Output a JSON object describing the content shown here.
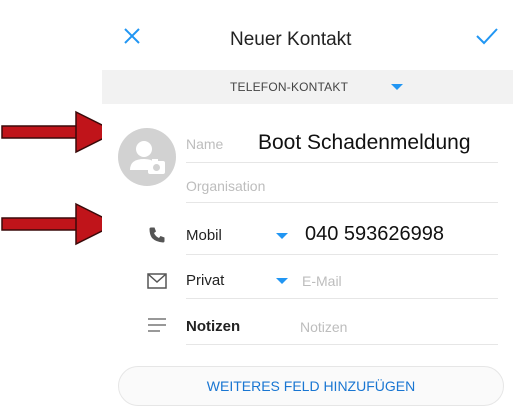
{
  "header": {
    "title": "Neuer Kontakt"
  },
  "contact_type": {
    "label": "TELEFON-KONTAKT"
  },
  "fields": {
    "name_label": "Name",
    "name_value": "Boot Schadenmeldung",
    "organisation_placeholder": "Organisation",
    "phone_type": "Mobil",
    "phone_value": "040 593626998",
    "email_type": "Privat",
    "email_placeholder": "E-Mail",
    "notes_label": "Notizen",
    "notes_placeholder": "Notizen"
  },
  "footer": {
    "add_field_label": "WEITERES FELD HINZUFÜGEN"
  },
  "colors": {
    "accent": "#2196f3",
    "arrow": "#c0141a"
  },
  "icons": {
    "close": "close-icon",
    "confirm": "check-icon",
    "avatar": "camera-avatar-icon",
    "phone": "phone-icon",
    "email": "envelope-icon",
    "notes": "notes-icon",
    "arrows": "red-arrow-icon"
  }
}
